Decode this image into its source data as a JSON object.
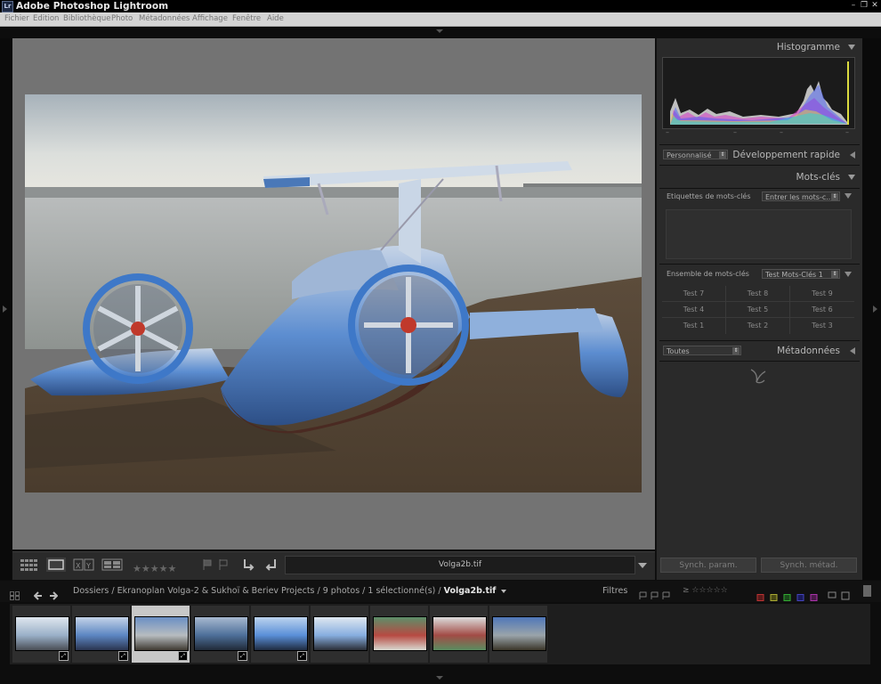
{
  "app": {
    "title": "Adobe Photoshop Lightroom",
    "icon_text": "Lr"
  },
  "menu": [
    "Fichier",
    "Edition",
    "Bibliothèque",
    "Photo",
    "Métadonnées",
    "Affichage",
    "Fenêtre",
    "Aide"
  ],
  "toolbar": {
    "filename": "Volga2b.tif",
    "stars": "★★★★★"
  },
  "right_panel": {
    "histogram_label": "Histogramme",
    "histo_marks": [
      "–",
      "–",
      "–",
      "–"
    ],
    "quick_develop": {
      "preset": "Personnalisé",
      "label": "Développement rapide"
    },
    "keywords_header": "Mots-clés",
    "keyword_tags": {
      "label": "Etiquettes de mots-clés",
      "select": "Entrer les mots-c..."
    },
    "keyword_set": {
      "label": "Ensemble de mots-clés",
      "select": "Test Mots-Clés 1"
    },
    "keyword_grid": [
      "Test 7",
      "Test 8",
      "Test 9",
      "Test 4",
      "Test 5",
      "Test 6",
      "Test 1",
      "Test 2",
      "Test 3"
    ],
    "metadata": {
      "preset": "Toutes",
      "label": "Métadonnées"
    },
    "sync_settings": "Synch. param.",
    "sync_metadata": "Synch. métad."
  },
  "filmstrip": {
    "breadcrumb": "Dossiers / Ekranoplan Volga-2 & Sukhoï & Beriev Projects / 9 photos / 1 sélectionné(s) / ",
    "current": "Volga2b.tif",
    "filters_label": "Filtres",
    "thumbnails": [
      {
        "name": "thumb-1",
        "colors": [
          "#9ab0c8",
          "#dfe6ee",
          "#4a4e55"
        ]
      },
      {
        "name": "thumb-2",
        "colors": [
          "#5c86c2",
          "#c4d3e8",
          "#2a3550"
        ]
      },
      {
        "name": "thumb-3",
        "colors": [
          "#b7bcc0",
          "#6a8fc4",
          "#3f3a32"
        ]
      },
      {
        "name": "thumb-4",
        "colors": [
          "#4d6f99",
          "#a8b9d0",
          "#202a38"
        ]
      },
      {
        "name": "thumb-5",
        "colors": [
          "#5a8fd8",
          "#bcd3ee",
          "#1f2b40"
        ]
      },
      {
        "name": "thumb-6",
        "colors": [
          "#87aee0",
          "#dfe7f0",
          "#2b2e36"
        ]
      },
      {
        "name": "thumb-7",
        "colors": [
          "#b74a42",
          "#5c8f6a",
          "#d8d8d0"
        ]
      },
      {
        "name": "thumb-8",
        "colors": [
          "#a24b45",
          "#dcdcdc",
          "#5a8d60"
        ]
      },
      {
        "name": "thumb-9",
        "colors": [
          "#9aa4aa",
          "#4f77b8",
          "#3b3629"
        ]
      }
    ]
  }
}
